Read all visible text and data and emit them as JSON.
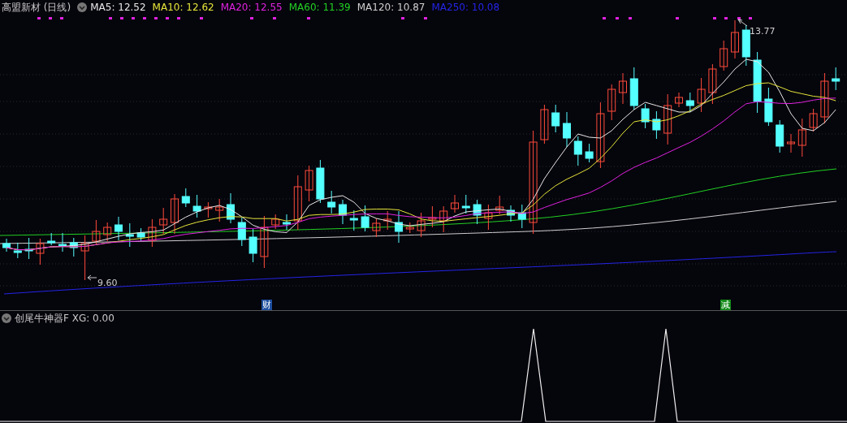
{
  "chart": {
    "title": "高盟新材 (日线)",
    "indicators": [
      {
        "label": "MA5: 12.52",
        "color": "#e8e8e8"
      },
      {
        "label": "MA10: 12.62",
        "color": "#e6e63a"
      },
      {
        "label": "MA20: 12.55",
        "color": "#e022e0"
      },
      {
        "label": "MA60: 11.39",
        "color": "#22d022"
      },
      {
        "label": "MA120: 10.87",
        "color": "#cfcfcf"
      },
      {
        "label": "MA250: 10.08",
        "color": "#2424e6"
      }
    ],
    "high_label": "13.77",
    "low_label": "9.60",
    "event_tags": [
      {
        "text": "财",
        "color": "#1d4f9e"
      },
      {
        "text": "减",
        "color": "#138a18"
      }
    ]
  },
  "sub_chart": {
    "title": "创尾牛神器F XG: 0.00"
  }
}
